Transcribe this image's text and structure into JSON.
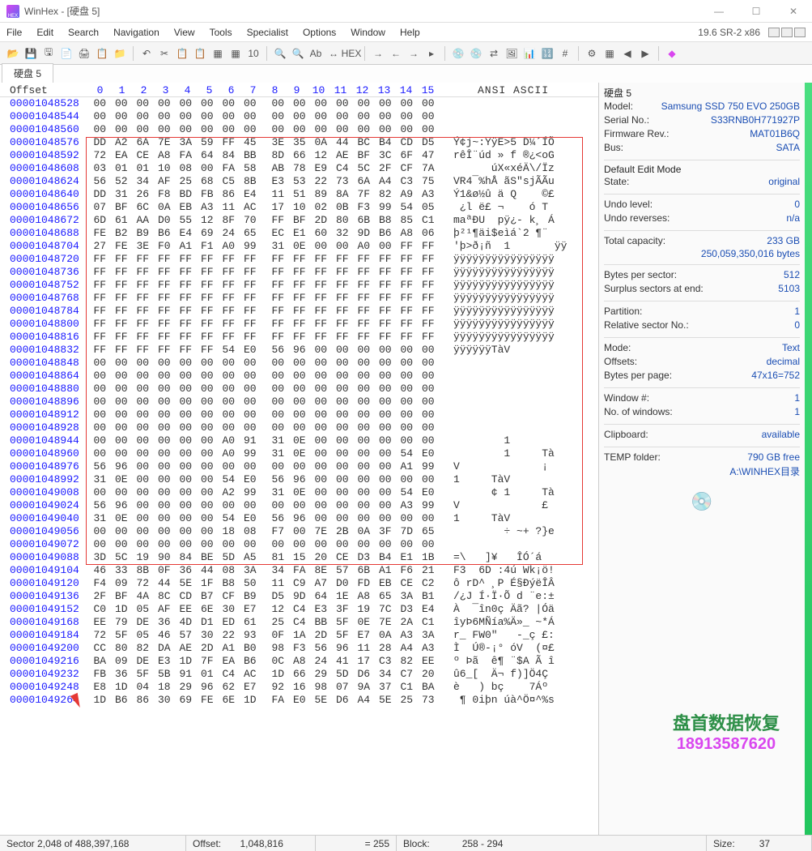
{
  "window": {
    "title": "WinHex - [硬盘 5]"
  },
  "menu": {
    "file": "File",
    "edit": "Edit",
    "search": "Search",
    "navigation": "Navigation",
    "view": "View",
    "tools": "Tools",
    "specialist": "Specialist",
    "options": "Options",
    "window": "Window",
    "help": "Help"
  },
  "version": "19.6 SR-2 x86",
  "tab": {
    "label": "硬盘 5"
  },
  "header": {
    "offset": "Offset",
    "cols": [
      "0",
      "1",
      "2",
      "3",
      "4",
      "5",
      "6",
      "7",
      "8",
      "9",
      "10",
      "11",
      "12",
      "13",
      "14",
      "15"
    ],
    "ascii": "ANSI ASCII"
  },
  "rows": [
    {
      "addr": "00001048528",
      "hex": [
        "00",
        "00",
        "00",
        "00",
        "00",
        "00",
        "00",
        "00",
        "00",
        "00",
        "00",
        "00",
        "00",
        "00",
        "00",
        "00"
      ],
      "ascii": ""
    },
    {
      "addr": "00001048544",
      "hex": [
        "00",
        "00",
        "00",
        "00",
        "00",
        "00",
        "00",
        "00",
        "00",
        "00",
        "00",
        "00",
        "00",
        "00",
        "00",
        "00"
      ],
      "ascii": ""
    },
    {
      "addr": "00001048560",
      "hex": [
        "00",
        "00",
        "00",
        "00",
        "00",
        "00",
        "00",
        "00",
        "00",
        "00",
        "00",
        "00",
        "00",
        "00",
        "00",
        "00"
      ],
      "ascii": ""
    },
    {
      "addr": "00001048576",
      "hex": [
        "DD",
        "A2",
        "6A",
        "7E",
        "3A",
        "59",
        "FF",
        "45",
        "3E",
        "35",
        "0A",
        "44",
        "BC",
        "B4",
        "CD",
        "D5"
      ],
      "ascii": "Ý¢j~:YÿE>5 D¼´ÍÕ"
    },
    {
      "addr": "00001048592",
      "hex": [
        "72",
        "EA",
        "CE",
        "A8",
        "FA",
        "64",
        "84",
        "BB",
        "8D",
        "66",
        "12",
        "AE",
        "BF",
        "3C",
        "6F",
        "47"
      ],
      "ascii": "rêÎ¨úd » f ®¿<oG"
    },
    {
      "addr": "00001048608",
      "hex": [
        "03",
        "01",
        "01",
        "10",
        "08",
        "00",
        "FA",
        "58",
        "AB",
        "78",
        "E9",
        "C4",
        "5C",
        "2F",
        "CF",
        "7A"
      ],
      "ascii": "      úX«xéÄ\\/Ïz"
    },
    {
      "addr": "00001048624",
      "hex": [
        "56",
        "52",
        "34",
        "AF",
        "25",
        "68",
        "C5",
        "8B",
        "E3",
        "53",
        "22",
        "73",
        "6A",
        "A4",
        "C3",
        "75"
      ],
      "ascii": "VR4¯%hÅ ãS\"sjÃÃu"
    },
    {
      "addr": "00001048640",
      "hex": [
        "DD",
        "31",
        "26",
        "F8",
        "BD",
        "FB",
        "86",
        "E4",
        "11",
        "51",
        "89",
        "8A",
        "7F",
        "82",
        "A9",
        "A3"
      ],
      "ascii": "Ý1&ø½û ä Q    ©£"
    },
    {
      "addr": "00001048656",
      "hex": [
        "07",
        "BF",
        "6C",
        "0A",
        "EB",
        "A3",
        "11",
        "AC",
        "17",
        "10",
        "02",
        "0B",
        "F3",
        "99",
        "54",
        "05"
      ],
      "ascii": " ¿l ë£ ¬    ó T "
    },
    {
      "addr": "00001048672",
      "hex": [
        "6D",
        "61",
        "AA",
        "D0",
        "55",
        "12",
        "8F",
        "70",
        "FF",
        "BF",
        "2D",
        "80",
        "6B",
        "B8",
        "85",
        "C1"
      ],
      "ascii": "maªÐU  pÿ¿- k¸ Á"
    },
    {
      "addr": "00001048688",
      "hex": [
        "FE",
        "B2",
        "B9",
        "B6",
        "E4",
        "69",
        "24",
        "65",
        "EC",
        "E1",
        "60",
        "32",
        "9D",
        "B6",
        "A8",
        "06"
      ],
      "ascii": "þ²¹¶äi$eìá`2 ¶¨ "
    },
    {
      "addr": "00001048704",
      "hex": [
        "27",
        "FE",
        "3E",
        "F0",
        "A1",
        "F1",
        "A0",
        "99",
        "31",
        "0E",
        "00",
        "00",
        "A0",
        "00",
        "FF",
        "FF"
      ],
      "ascii": "'þ>ð¡ñ  1       ÿÿ"
    },
    {
      "addr": "00001048720",
      "hex": [
        "FF",
        "FF",
        "FF",
        "FF",
        "FF",
        "FF",
        "FF",
        "FF",
        "FF",
        "FF",
        "FF",
        "FF",
        "FF",
        "FF",
        "FF",
        "FF"
      ],
      "ascii": "ÿÿÿÿÿÿÿÿÿÿÿÿÿÿÿÿ"
    },
    {
      "addr": "00001048736",
      "hex": [
        "FF",
        "FF",
        "FF",
        "FF",
        "FF",
        "FF",
        "FF",
        "FF",
        "FF",
        "FF",
        "FF",
        "FF",
        "FF",
        "FF",
        "FF",
        "FF"
      ],
      "ascii": "ÿÿÿÿÿÿÿÿÿÿÿÿÿÿÿÿ"
    },
    {
      "addr": "00001048752",
      "hex": [
        "FF",
        "FF",
        "FF",
        "FF",
        "FF",
        "FF",
        "FF",
        "FF",
        "FF",
        "FF",
        "FF",
        "FF",
        "FF",
        "FF",
        "FF",
        "FF"
      ],
      "ascii": "ÿÿÿÿÿÿÿÿÿÿÿÿÿÿÿÿ"
    },
    {
      "addr": "00001048768",
      "hex": [
        "FF",
        "FF",
        "FF",
        "FF",
        "FF",
        "FF",
        "FF",
        "FF",
        "FF",
        "FF",
        "FF",
        "FF",
        "FF",
        "FF",
        "FF",
        "FF"
      ],
      "ascii": "ÿÿÿÿÿÿÿÿÿÿÿÿÿÿÿÿ"
    },
    {
      "addr": "00001048784",
      "hex": [
        "FF",
        "FF",
        "FF",
        "FF",
        "FF",
        "FF",
        "FF",
        "FF",
        "FF",
        "FF",
        "FF",
        "FF",
        "FF",
        "FF",
        "FF",
        "FF"
      ],
      "ascii": "ÿÿÿÿÿÿÿÿÿÿÿÿÿÿÿÿ"
    },
    {
      "addr": "00001048800",
      "hex": [
        "FF",
        "FF",
        "FF",
        "FF",
        "FF",
        "FF",
        "FF",
        "FF",
        "FF",
        "FF",
        "FF",
        "FF",
        "FF",
        "FF",
        "FF",
        "FF"
      ],
      "ascii": "ÿÿÿÿÿÿÿÿÿÿÿÿÿÿÿÿ"
    },
    {
      "addr": "00001048816",
      "hex": [
        "FF",
        "FF",
        "FF",
        "FF",
        "FF",
        "FF",
        "FF",
        "FF",
        "FF",
        "FF",
        "FF",
        "FF",
        "FF",
        "FF",
        "FF",
        "FF"
      ],
      "ascii": "ÿÿÿÿÿÿÿÿÿÿÿÿÿÿÿÿ"
    },
    {
      "addr": "00001048832",
      "hex": [
        "FF",
        "FF",
        "FF",
        "FF",
        "FF",
        "FF",
        "54",
        "E0",
        "56",
        "96",
        "00",
        "00",
        "00",
        "00",
        "00",
        "00"
      ],
      "ascii": "ÿÿÿÿÿÿTàV "
    },
    {
      "addr": "00001048848",
      "hex": [
        "00",
        "00",
        "00",
        "00",
        "00",
        "00",
        "00",
        "00",
        "00",
        "00",
        "00",
        "00",
        "00",
        "00",
        "00",
        "00"
      ],
      "ascii": ""
    },
    {
      "addr": "00001048864",
      "hex": [
        "00",
        "00",
        "00",
        "00",
        "00",
        "00",
        "00",
        "00",
        "00",
        "00",
        "00",
        "00",
        "00",
        "00",
        "00",
        "00"
      ],
      "ascii": ""
    },
    {
      "addr": "00001048880",
      "hex": [
        "00",
        "00",
        "00",
        "00",
        "00",
        "00",
        "00",
        "00",
        "00",
        "00",
        "00",
        "00",
        "00",
        "00",
        "00",
        "00"
      ],
      "ascii": ""
    },
    {
      "addr": "00001048896",
      "hex": [
        "00",
        "00",
        "00",
        "00",
        "00",
        "00",
        "00",
        "00",
        "00",
        "00",
        "00",
        "00",
        "00",
        "00",
        "00",
        "00"
      ],
      "ascii": ""
    },
    {
      "addr": "00001048912",
      "hex": [
        "00",
        "00",
        "00",
        "00",
        "00",
        "00",
        "00",
        "00",
        "00",
        "00",
        "00",
        "00",
        "00",
        "00",
        "00",
        "00"
      ],
      "ascii": ""
    },
    {
      "addr": "00001048928",
      "hex": [
        "00",
        "00",
        "00",
        "00",
        "00",
        "00",
        "00",
        "00",
        "00",
        "00",
        "00",
        "00",
        "00",
        "00",
        "00",
        "00"
      ],
      "ascii": ""
    },
    {
      "addr": "00001048944",
      "hex": [
        "00",
        "00",
        "00",
        "00",
        "00",
        "00",
        "A0",
        "91",
        "31",
        "0E",
        "00",
        "00",
        "00",
        "00",
        "00",
        "00"
      ],
      "ascii": "        1"
    },
    {
      "addr": "00001048960",
      "hex": [
        "00",
        "00",
        "00",
        "00",
        "00",
        "00",
        "A0",
        "99",
        "31",
        "0E",
        "00",
        "00",
        "00",
        "00",
        "54",
        "E0"
      ],
      "ascii": "        1     Tà"
    },
    {
      "addr": "00001048976",
      "hex": [
        "56",
        "96",
        "00",
        "00",
        "00",
        "00",
        "00",
        "00",
        "00",
        "00",
        "00",
        "00",
        "00",
        "00",
        "A1",
        "99"
      ],
      "ascii": "V             ¡ "
    },
    {
      "addr": "00001048992",
      "hex": [
        "31",
        "0E",
        "00",
        "00",
        "00",
        "00",
        "54",
        "E0",
        "56",
        "96",
        "00",
        "00",
        "00",
        "00",
        "00",
        "00"
      ],
      "ascii": "1     TàV "
    },
    {
      "addr": "00001049008",
      "hex": [
        "00",
        "00",
        "00",
        "00",
        "00",
        "00",
        "A2",
        "99",
        "31",
        "0E",
        "00",
        "00",
        "00",
        "00",
        "54",
        "E0"
      ],
      "ascii": "      ¢ 1     Tà"
    },
    {
      "addr": "00001049024",
      "hex": [
        "56",
        "96",
        "00",
        "00",
        "00",
        "00",
        "00",
        "00",
        "00",
        "00",
        "00",
        "00",
        "00",
        "00",
        "A3",
        "99"
      ],
      "ascii": "V             £ "
    },
    {
      "addr": "00001049040",
      "hex": [
        "31",
        "0E",
        "00",
        "00",
        "00",
        "00",
        "54",
        "E0",
        "56",
        "96",
        "00",
        "00",
        "00",
        "00",
        "00",
        "00"
      ],
      "ascii": "1     TàV "
    },
    {
      "addr": "00001049056",
      "hex": [
        "00",
        "00",
        "00",
        "00",
        "00",
        "00",
        "18",
        "08",
        "F7",
        "00",
        "7E",
        "2B",
        "0A",
        "3F",
        "7D",
        "65"
      ],
      "ascii": "        ÷ ~+ ?}e"
    },
    {
      "addr": "00001049072",
      "hex": [
        "00",
        "00",
        "00",
        "00",
        "00",
        "00",
        "00",
        "00",
        "00",
        "00",
        "00",
        "00",
        "00",
        "00",
        "00",
        "00"
      ],
      "ascii": ""
    },
    {
      "addr": "00001049088",
      "hex": [
        "3D",
        "5C",
        "19",
        "90",
        "84",
        "BE",
        "5D",
        "A5",
        "81",
        "15",
        "20",
        "CE",
        "D3",
        "B4",
        "E1",
        "1B"
      ],
      "ascii": "=\\   ]¥   ÎÓ´á "
    },
    {
      "addr": "00001049104",
      "hex": [
        "46",
        "33",
        "8B",
        "0F",
        "36",
        "44",
        "08",
        "3A",
        "34",
        "FA",
        "8E",
        "57",
        "6B",
        "A1",
        "F6",
        "21"
      ],
      "ascii": "F3  6D :4ú Wk¡ö!"
    },
    {
      "addr": "00001049120",
      "hex": [
        "F4",
        "09",
        "72",
        "44",
        "5E",
        "1F",
        "B8",
        "50",
        "11",
        "C9",
        "A7",
        "D0",
        "FD",
        "EB",
        "CE",
        "C2"
      ],
      "ascii": "ô rD^ ¸P É§ÐýëÎÂ"
    },
    {
      "addr": "00001049136",
      "hex": [
        "2F",
        "BF",
        "4A",
        "8C",
        "CD",
        "B7",
        "CF",
        "B9",
        "D5",
        "9D",
        "64",
        "1E",
        "A8",
        "65",
        "3A",
        "B1"
      ],
      "ascii": "/¿J Í·Ï·Õ d ¨e:±"
    },
    {
      "addr": "00001049152",
      "hex": [
        "C0",
        "1D",
        "05",
        "AF",
        "EE",
        "6E",
        "30",
        "E7",
        "12",
        "C4",
        "E3",
        "3F",
        "19",
        "7C",
        "D3",
        "E4"
      ],
      "ascii": "À  ¯în0ç Äã? |Óä"
    },
    {
      "addr": "00001049168",
      "hex": [
        "EE",
        "79",
        "DE",
        "36",
        "4D",
        "D1",
        "ED",
        "61",
        "25",
        "C4",
        "BB",
        "5F",
        "0E",
        "7E",
        "2A",
        "C1"
      ],
      "ascii": "îyÞ6MÑía%Ä»_ ~*Á"
    },
    {
      "addr": "00001049184",
      "hex": [
        "72",
        "5F",
        "05",
        "46",
        "57",
        "30",
        "22",
        "93",
        "0F",
        "1A",
        "2D",
        "5F",
        "E7",
        "0A",
        "A3",
        "3A"
      ],
      "ascii": "r_ FW0\"   -_ç £:"
    },
    {
      "addr": "00001049200",
      "hex": [
        "CC",
        "80",
        "82",
        "DA",
        "AE",
        "2D",
        "A1",
        "B0",
        "98",
        "F3",
        "56",
        "96",
        "11",
        "28",
        "A4",
        "A3"
      ],
      "ascii": "Ì  Ú®-¡° óV  (¤£"
    },
    {
      "addr": "00001049216",
      "hex": [
        "BA",
        "09",
        "DE",
        "E3",
        "1D",
        "7F",
        "EA",
        "B6",
        "0C",
        "A8",
        "24",
        "41",
        "17",
        "C3",
        "82",
        "EE"
      ],
      "ascii": "º Þã  ê¶ ¨$A Ã î"
    },
    {
      "addr": "00001049232",
      "hex": [
        "FB",
        "36",
        "5F",
        "5B",
        "91",
        "01",
        "C4",
        "AC",
        "1D",
        "66",
        "29",
        "5D",
        "D6",
        "34",
        "C7",
        "20"
      ],
      "ascii": "û6_[  Ä¬ f)]Ö4Ç "
    },
    {
      "addr": "00001049248",
      "hex": [
        "E8",
        "1D",
        "04",
        "18",
        "29",
        "96",
        "62",
        "E7",
        "92",
        "16",
        "98",
        "07",
        "9A",
        "37",
        "C1",
        "BA"
      ],
      "ascii": "è   ) bç    7Áº"
    },
    {
      "addr": "00001049264",
      "hex": [
        "1D",
        "B6",
        "86",
        "30",
        "69",
        "FE",
        "6E",
        "1D",
        "FA",
        "E0",
        "5E",
        "D6",
        "A4",
        "5E",
        "25",
        "73"
      ],
      "ascii": " ¶ 0iþn úà^Ö¤^%s"
    }
  ],
  "info": {
    "title": "硬盘 5",
    "model_l": "Model:",
    "model_v": "Samsung SSD 750 EVO 250GB",
    "serial_l": "Serial No.:",
    "serial_v": "S33RNB0H771927P",
    "fw_l": "Firmware Rev.:",
    "fw_v": "MAT01B6Q",
    "bus_l": "Bus:",
    "bus_v": "SATA",
    "dem_t": "Default Edit Mode",
    "state_l": "State:",
    "state_v": "original",
    "undo_l": "Undo level:",
    "undo_v": "0",
    "undor_l": "Undo reverses:",
    "undor_v": "n/a",
    "cap_l": "Total capacity:",
    "cap_v": "233 GB",
    "cap_s": "250,059,350,016 bytes",
    "bps_l": "Bytes per sector:",
    "bps_v": "512",
    "sse_l": "Surplus sectors at end:",
    "sse_v": "5103",
    "part_l": "Partition:",
    "part_v": "1",
    "rsn_l": "Relative sector No.:",
    "rsn_v": "0",
    "mode_l": "Mode:",
    "mode_v": "Text",
    "off_l": "Offsets:",
    "off_v": "decimal",
    "bpp_l": "Bytes per page:",
    "bpp_v": "47x16=752",
    "win_l": "Window #:",
    "win_v": "1",
    "now_l": "No. of windows:",
    "now_v": "1",
    "clip_l": "Clipboard:",
    "clip_v": "available",
    "tmp_l": "TEMP folder:",
    "tmp_v": "790 GB free",
    "tmp_s": "A:\\WINHEX目录"
  },
  "watermark": {
    "cn": "盘首数据恢复",
    "phone": "18913587620"
  },
  "status": {
    "sector": "Sector 2,048 of 488,397,168",
    "offset_l": "Offset:",
    "offset_v": "1,048,816",
    "eq": "= 255",
    "block_l": "Block:",
    "block_v": "258 - 294",
    "size_l": "Size:",
    "size_v": "37"
  }
}
